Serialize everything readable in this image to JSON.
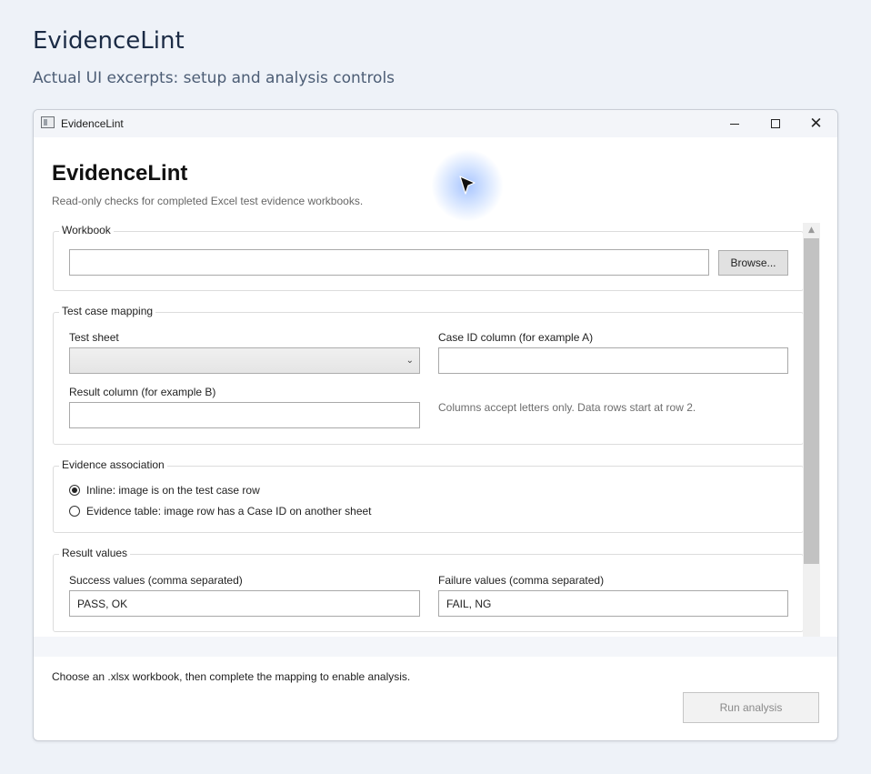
{
  "page": {
    "title": "EvidenceLint",
    "subtitle": "Actual UI excerpts: setup and analysis controls"
  },
  "window": {
    "title": "EvidenceLint",
    "controls": {
      "minimize": "minimize-icon",
      "maximize": "maximize-icon",
      "close": "close-icon"
    }
  },
  "app": {
    "heading": "EvidenceLint",
    "description": "Read-only checks for completed Excel test evidence workbooks."
  },
  "workbook": {
    "label": "Workbook",
    "path_value": "",
    "browse_label": "Browse..."
  },
  "mapping": {
    "label": "Test case mapping",
    "test_sheet_label": "Test sheet",
    "test_sheet_value": "",
    "case_id_label": "Case ID column (for example A)",
    "case_id_value": "",
    "result_col_label": "Result column (for example B)",
    "result_col_value": "",
    "hint": "Columns accept letters only. Data rows start at row 2."
  },
  "association": {
    "label": "Evidence association",
    "options": [
      {
        "label": "Inline: image is on the test case row",
        "checked": true
      },
      {
        "label": "Evidence table: image row has a Case ID on another sheet",
        "checked": false
      }
    ]
  },
  "results": {
    "label": "Result values",
    "success_label": "Success values (comma separated)",
    "success_value": "PASS, OK",
    "failure_label": "Failure values (comma separated)",
    "failure_value": "FAIL, NG"
  },
  "footer": {
    "status": "Choose an .xlsx workbook, then complete the mapping to enable analysis.",
    "run_label": "Run analysis",
    "run_enabled": false
  },
  "colors": {
    "background": "#eef2f8",
    "title": "#1b2b45",
    "cursor_glow": "#6096ff"
  }
}
